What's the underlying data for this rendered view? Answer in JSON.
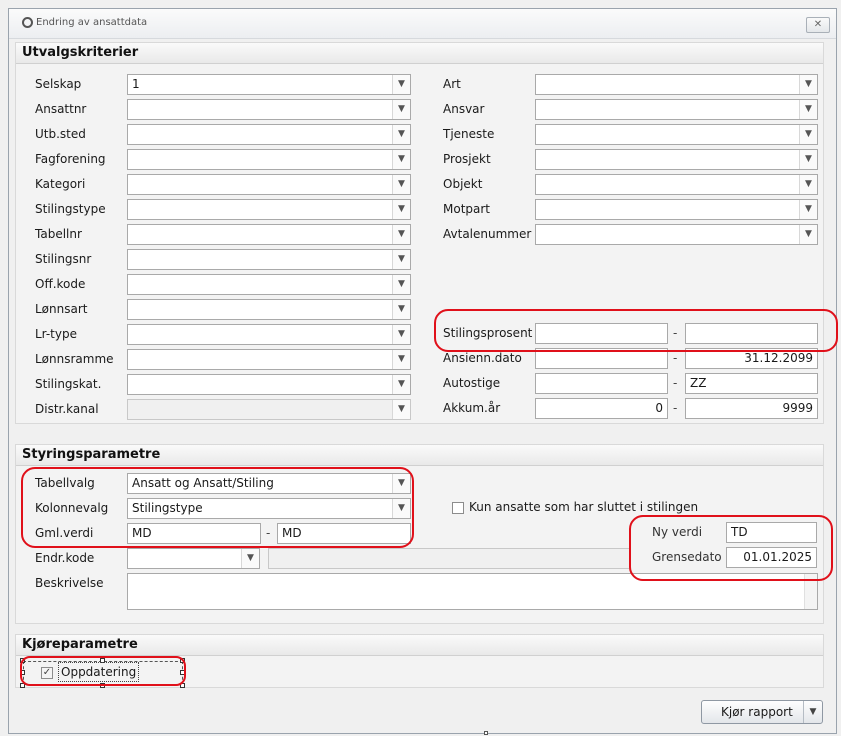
{
  "window": {
    "title": "Endring av ansattdata",
    "close_label": "✕"
  },
  "utvalg": {
    "header": "Utvalgskriterier",
    "left": [
      {
        "label": "Selskap",
        "value": "1"
      },
      {
        "label": "Ansattnr",
        "value": ""
      },
      {
        "label": "Utb.sted",
        "value": ""
      },
      {
        "label": "Fagforening",
        "value": ""
      },
      {
        "label": "Kategori",
        "value": ""
      },
      {
        "label": "Stilingstype",
        "value": ""
      },
      {
        "label": "Tabellnr",
        "value": ""
      },
      {
        "label": "Stilingsnr",
        "value": ""
      },
      {
        "label": "Off.kode",
        "value": ""
      },
      {
        "label": "Lønnsart",
        "value": ""
      },
      {
        "label": "Lr-type",
        "value": ""
      },
      {
        "label": "Lønnsramme",
        "value": ""
      },
      {
        "label": "Stilingskat.",
        "value": ""
      },
      {
        "label": "Distr.kanal",
        "value": ""
      }
    ],
    "right": [
      {
        "label": "Art",
        "value": ""
      },
      {
        "label": "Ansvar",
        "value": ""
      },
      {
        "label": "Tjeneste",
        "value": ""
      },
      {
        "label": "Prosjekt",
        "value": ""
      },
      {
        "label": "Objekt",
        "value": ""
      },
      {
        "label": "Motpart",
        "value": ""
      },
      {
        "label": "Avtalenummer",
        "value": ""
      }
    ],
    "ranges": [
      {
        "label": "Stilingsprosent",
        "from": "",
        "to": ""
      },
      {
        "label": "Ansienn.dato",
        "from": "",
        "to": "31.12.2099"
      },
      {
        "label": "Autostige",
        "from": "",
        "to": "ZZ"
      },
      {
        "label": "Akkum.år",
        "from": "0",
        "to": "9999"
      }
    ],
    "range_separator": "-"
  },
  "styring": {
    "header": "Styringsparametre",
    "tabellvalg": {
      "label": "Tabellvalg",
      "value": "Ansatt og Ansatt/Stiling"
    },
    "kolonnevalg": {
      "label": "Kolonnevalg",
      "value": "Stilingstype"
    },
    "gml_verdi": {
      "label": "Gml.verdi",
      "from": "MD",
      "to": "MD"
    },
    "endr_kode": {
      "label": "Endr.kode",
      "value": ""
    },
    "beskrivelse": {
      "label": "Beskrivelse",
      "value": ""
    },
    "kun_sluttet": {
      "label": "Kun ansatte som har sluttet i stilingen",
      "checked": false
    },
    "ny_verdi": {
      "label": "Ny verdi",
      "value": "TD"
    },
    "grensedato": {
      "label": "Grensedato",
      "value": "01.01.2025"
    }
  },
  "kjore": {
    "header": "Kjøreparametre",
    "oppdatering": {
      "label": "Oppdatering",
      "checked": true
    }
  },
  "footer": {
    "run_label": "Kjør rapport"
  },
  "colors": {
    "highlight": "#e0101a",
    "accent": "#3399ff"
  }
}
